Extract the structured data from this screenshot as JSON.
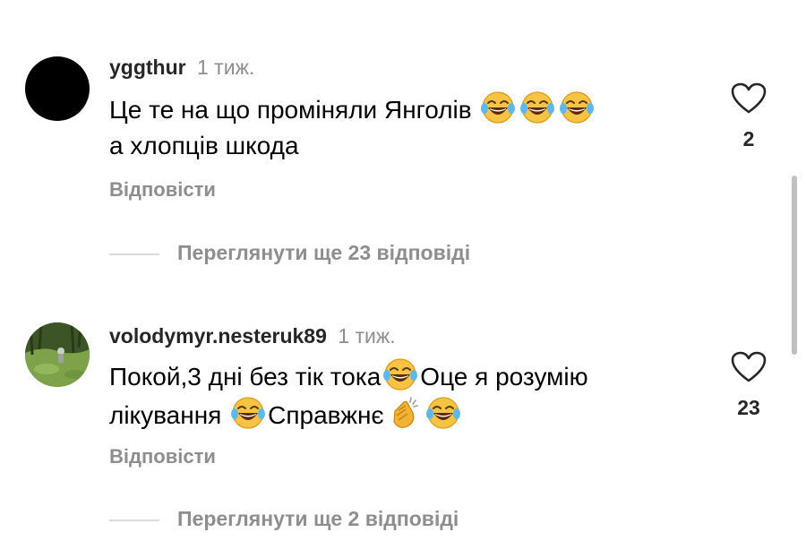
{
  "comments": [
    {
      "username": "yggthur",
      "time": "1 тиж.",
      "line1_text": "Це те на що проміняли Янголів",
      "line2_text": "а хлопців шкода",
      "likes": "2",
      "reply_label": "Відповісти",
      "view_replies_label": "Переглянути ще 23 відповіді",
      "avatar": "black-circle"
    },
    {
      "username": "volodymyr.nesteruk89",
      "time": "1 тиж.",
      "line1_text_a": "Покой,3 дні без тік тока",
      "line1_text_b": "Оце я розумію",
      "line2_text_a": "лікування",
      "line2_text_b": "Справжнє",
      "likes": "23",
      "reply_label": "Відповісти",
      "view_replies_label": "Переглянути ще 2 відповіді",
      "avatar": "forest-photo"
    }
  ],
  "icons": {
    "like": "heart-outline-icon",
    "laugh": "face-with-tears-of-joy-emoji",
    "clap": "clapping-hands-emoji"
  },
  "colors": {
    "secondary_text": "#8e8e8e",
    "username": "#262626",
    "divider": "#dbdbdb",
    "emoji_yellow": "#f6c343"
  }
}
